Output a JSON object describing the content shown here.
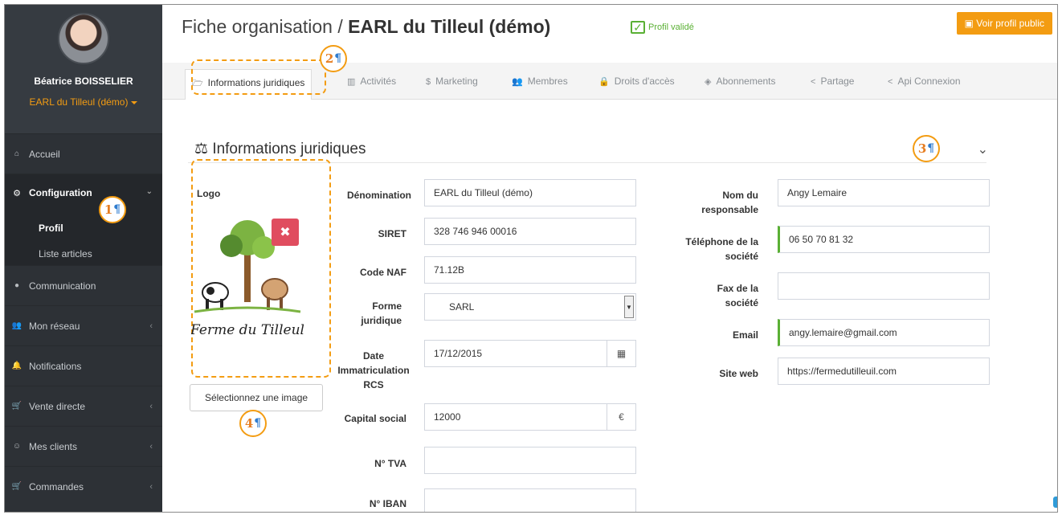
{
  "sidebar": {
    "user_name": "Béatrice BOISSELIER",
    "org": "EARL du Tilleul (démo)",
    "items": [
      {
        "label": "Accueil",
        "icon": "home-icon",
        "glyph": "⌂"
      },
      {
        "label": "Configuration",
        "icon": "cogs-icon",
        "glyph": "⚙"
      },
      {
        "label": "Communication",
        "icon": "comments-icon",
        "glyph": "●"
      },
      {
        "label": "Mon réseau",
        "icon": "users-icon",
        "glyph": "👥"
      },
      {
        "label": "Notifications",
        "icon": "bell-icon",
        "glyph": "🔔"
      },
      {
        "label": "Vente directe",
        "icon": "cart-icon",
        "glyph": "🛒"
      },
      {
        "label": "Mes clients",
        "icon": "handshake-icon",
        "glyph": "☺"
      },
      {
        "label": "Commandes",
        "icon": "cart-arrow-icon",
        "glyph": "🛒"
      }
    ],
    "submenu": [
      "Profil",
      "Liste articles"
    ]
  },
  "header": {
    "title_prefix": "Fiche organisation / ",
    "title_org": "EARL du Tilleul (démo)",
    "validated": "Profil validé",
    "public_button": "Voir profil public"
  },
  "tabs": [
    {
      "label": "Informations juridiques",
      "icon": "folder-open-icon",
      "glyph": "🗁"
    },
    {
      "label": "Activités",
      "icon": "bar-chart-icon",
      "glyph": "▥"
    },
    {
      "label": "Marketing",
      "icon": "dollar-icon",
      "glyph": "$"
    },
    {
      "label": "Membres",
      "icon": "users-icon",
      "glyph": "👥"
    },
    {
      "label": "Droits d'accès",
      "icon": "lock-icon",
      "glyph": "🔒"
    },
    {
      "label": "Abonnements",
      "icon": "tag-icon",
      "glyph": "◈"
    },
    {
      "label": "Partage",
      "icon": "share-icon",
      "glyph": "<"
    },
    {
      "label": "Api Connexion",
      "icon": "share-icon",
      "glyph": "<"
    }
  ],
  "section": {
    "title": "Informations juridiques",
    "icon": "balance-scale-icon"
  },
  "logo": {
    "label": "Logo",
    "select_button": "Sélectionnez une image",
    "logo_text": "Ferme du Tilleul"
  },
  "form_left": {
    "denomination": {
      "label": "Dénomination",
      "value": "EARL du Tilleul (démo)"
    },
    "siret": {
      "label": "SIRET",
      "value": "328 746 946 00016"
    },
    "naf": {
      "label": "Code NAF",
      "value": "71.12B"
    },
    "forme": {
      "label": "Forme juridique",
      "value": "SARL"
    },
    "date": {
      "label": "Date Immatriculation RCS",
      "value": "17/12/2015"
    },
    "capital": {
      "label": "Capital social",
      "value": "12000",
      "unit": "€"
    },
    "tva": {
      "label": "N° TVA",
      "value": ""
    },
    "iban": {
      "label": "N° IBAN",
      "value": ""
    }
  },
  "form_right": {
    "responsable": {
      "label": "Nom du responsable",
      "value": "Angy Lemaire"
    },
    "telephone": {
      "label": "Téléphone de la société",
      "value": "06 50 70 81 32"
    },
    "fax": {
      "label": "Fax de la société",
      "value": ""
    },
    "email": {
      "label": "Email",
      "value": "angy.lemaire@gmail.com"
    },
    "site": {
      "label": "Site web",
      "value": "https://fermedutilleuil.com"
    }
  },
  "callouts": [
    "1",
    "2",
    "3",
    "4"
  ],
  "colors": {
    "accent": "#f39c12",
    "success": "#5ab034",
    "danger": "#e04d5f",
    "sidebar": "#2d3136"
  }
}
